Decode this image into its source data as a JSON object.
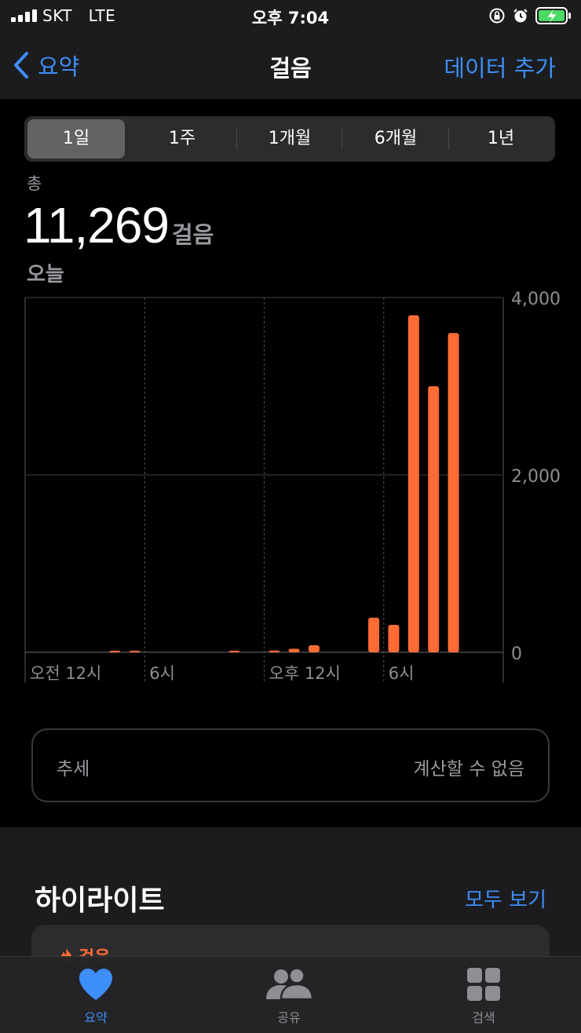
{
  "status_bar": {
    "carrier": "SKT",
    "network": "LTE",
    "time": "오후 7:04",
    "icons": [
      "signal-icon",
      "orientation-lock-icon",
      "alarm-icon",
      "battery-charging-icon"
    ]
  },
  "nav": {
    "back_label": "요약",
    "title": "걸음",
    "add_label": "데이터 추가"
  },
  "segments": [
    {
      "label": "1일",
      "selected": true
    },
    {
      "label": "1주",
      "selected": false
    },
    {
      "label": "1개월",
      "selected": false
    },
    {
      "label": "6개월",
      "selected": false
    },
    {
      "label": "1년",
      "selected": false
    }
  ],
  "summary": {
    "total_label": "총",
    "total_value": "11,269",
    "unit": "걸음",
    "date_label": "오늘"
  },
  "chart_data": {
    "type": "bar",
    "bar_color": "#ff6b35",
    "hours": [
      0,
      1,
      2,
      3,
      4,
      5,
      6,
      7,
      8,
      9,
      10,
      11,
      12,
      13,
      14,
      15,
      16,
      17,
      18,
      19,
      20,
      21,
      22,
      23
    ],
    "values": [
      0,
      0,
      0,
      0,
      12,
      10,
      0,
      0,
      0,
      0,
      8,
      0,
      20,
      40,
      80,
      0,
      0,
      390,
      310,
      3800,
      3000,
      3600,
      0,
      0
    ],
    "x_tick_labels": [
      "오전 12시",
      "6시",
      "오후 12시",
      "6시"
    ],
    "y_tick_labels": [
      "4,000",
      "2,000",
      "0"
    ],
    "ylim": [
      0,
      4000
    ],
    "grid": true
  },
  "trend": {
    "label": "추세",
    "value": "계산할 수 없음"
  },
  "highlights": {
    "title": "하이라이트",
    "see_all": "모두 보기",
    "card_label": "걸음"
  },
  "tabbar": {
    "tabs": [
      {
        "label": "요약",
        "icon": "heart-icon",
        "active": true
      },
      {
        "label": "공유",
        "icon": "people-icon",
        "active": false
      },
      {
        "label": "검색",
        "icon": "grid-icon",
        "active": false
      }
    ]
  }
}
